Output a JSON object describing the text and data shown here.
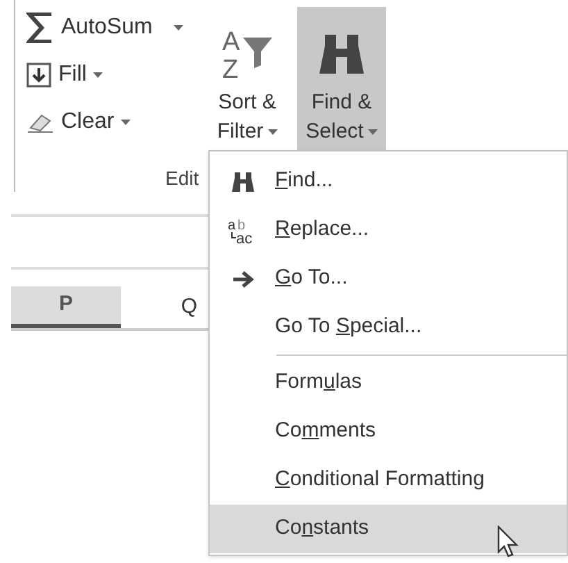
{
  "ribbon": {
    "small_buttons": [
      {
        "kind": "sum",
        "label": "AutoSum"
      },
      {
        "kind": "fill",
        "label": "Fill"
      },
      {
        "kind": "clear",
        "label": "Clear"
      }
    ],
    "large_buttons": [
      {
        "kind": "sort",
        "icon_letters": [
          "A",
          "Z"
        ],
        "label_lines": [
          "Sort &",
          "Filter"
        ],
        "selected": false
      },
      {
        "kind": "find",
        "label_lines": [
          "Find &",
          "Select"
        ],
        "selected": true
      }
    ],
    "group_label": "Edit"
  },
  "sheet": {
    "columns": [
      {
        "label": "P",
        "selected": true
      },
      {
        "label": "Q",
        "selected": false
      }
    ]
  },
  "menu": {
    "items": [
      {
        "kind": "find",
        "key": "F",
        "post": "ind...",
        "selected": false
      },
      {
        "kind": "replace",
        "icon_letters": [
          "a",
          "b",
          "ac"
        ],
        "key": "R",
        "post": "eplace...",
        "selected": false
      },
      {
        "kind": "goto",
        "key": "G",
        "post": "o To...",
        "selected": false
      },
      {
        "kind": "plain",
        "pre": "Go To ",
        "key": "S",
        "post": "pecial...",
        "selected": false
      },
      {
        "kind": "separator"
      },
      {
        "kind": "plain",
        "pre": "Form",
        "key": "u",
        "post": "las",
        "selected": false
      },
      {
        "kind": "plain",
        "pre": "Co",
        "key": "m",
        "post": "ments",
        "selected": false
      },
      {
        "kind": "plain",
        "key": "C",
        "post": "onditional Formatting",
        "selected": false
      },
      {
        "kind": "plain",
        "pre": "Co",
        "key": "n",
        "post": "stants",
        "selected": true
      }
    ]
  }
}
